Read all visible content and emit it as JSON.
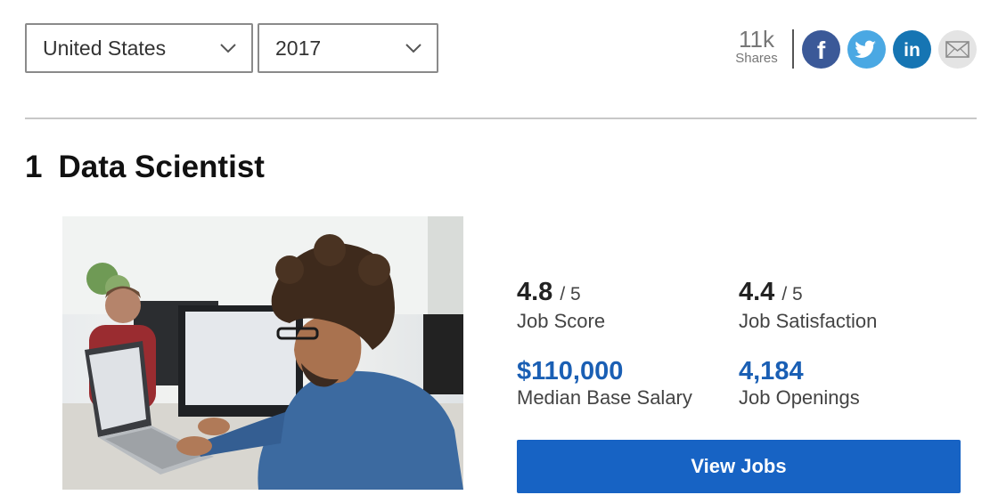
{
  "filters": {
    "country": "United States",
    "year": "2017"
  },
  "shares": {
    "count": "11k",
    "label": "Shares"
  },
  "social": [
    "facebook-icon",
    "twitter-icon",
    "linkedin-icon",
    "email-icon"
  ],
  "job": {
    "rank": "1",
    "title": "Data Scientist",
    "job_score": "4.8",
    "job_score_of": "/ 5",
    "job_score_label": "Job Score",
    "job_satisfaction": "4.4",
    "job_satisfaction_of": "/ 5",
    "job_satisfaction_label": "Job Satisfaction",
    "median_salary": "$110,000",
    "median_salary_label": "Median Base Salary",
    "job_openings": "4,184",
    "job_openings_label": "Job Openings",
    "cta_label": "View Jobs"
  },
  "colors": {
    "accent": "#1763c4",
    "value_blue": "#1a5fb4",
    "facebook": "#3b5998",
    "twitter": "#4aa8e3",
    "linkedin": "#1675b3"
  }
}
